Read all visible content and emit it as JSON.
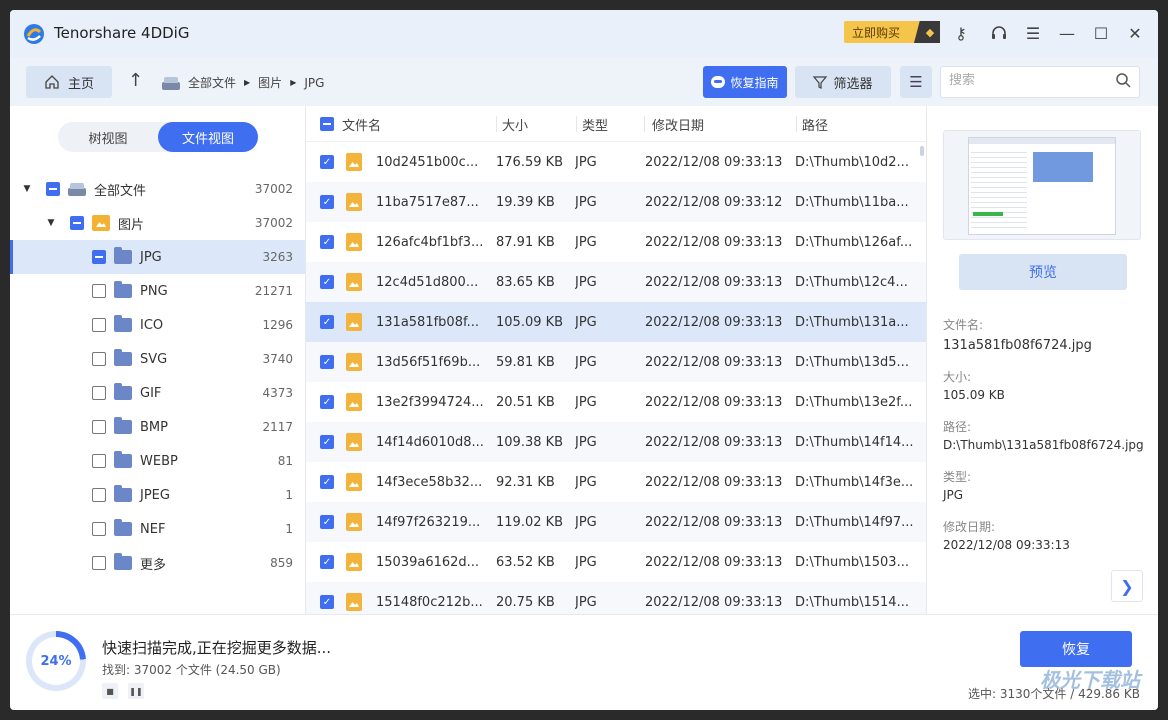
{
  "app": {
    "title": "Tenorshare 4DDiG",
    "buy_label": "立即购买"
  },
  "toolbar": {
    "home_label": "主页",
    "breadcrumb": [
      "全部文件",
      "图片",
      "JPG"
    ],
    "guide_label": "恢复指南",
    "filter_label": "筛选器",
    "search_placeholder": "搜索"
  },
  "sidebar": {
    "toggle": {
      "tree": "树视图",
      "file": "文件视图"
    },
    "items": [
      {
        "label": "全部文件",
        "count": "37002"
      },
      {
        "label": "图片",
        "count": "37002"
      },
      {
        "label": "JPG",
        "count": "3263"
      },
      {
        "label": "PNG",
        "count": "21271"
      },
      {
        "label": "ICO",
        "count": "1296"
      },
      {
        "label": "SVG",
        "count": "3740"
      },
      {
        "label": "GIF",
        "count": "4373"
      },
      {
        "label": "BMP",
        "count": "2117"
      },
      {
        "label": "WEBP",
        "count": "81"
      },
      {
        "label": "JPEG",
        "count": "1"
      },
      {
        "label": "NEF",
        "count": "1"
      },
      {
        "label": "更多",
        "count": "859"
      }
    ]
  },
  "table": {
    "headers": {
      "name": "文件名",
      "size": "大小",
      "type": "类型",
      "date": "修改日期",
      "path": "路径"
    },
    "rows": [
      {
        "name": "10d2451b00c...",
        "size": "176.59 KB",
        "type": "JPG",
        "date": "2022/12/08 09:33:13",
        "path": "D:\\Thumb\\10d2..."
      },
      {
        "name": "11ba7517e87...",
        "size": "19.39 KB",
        "type": "JPG",
        "date": "2022/12/08 09:33:12",
        "path": "D:\\Thumb\\11ba..."
      },
      {
        "name": "126afc4bf1bf3...",
        "size": "87.91 KB",
        "type": "JPG",
        "date": "2022/12/08 09:33:13",
        "path": "D:\\Thumb\\126af..."
      },
      {
        "name": "12c4d51d800...",
        "size": "83.65 KB",
        "type": "JPG",
        "date": "2022/12/08 09:33:13",
        "path": "D:\\Thumb\\12c4..."
      },
      {
        "name": "131a581fb08f...",
        "size": "105.09 KB",
        "type": "JPG",
        "date": "2022/12/08 09:33:13",
        "path": "D:\\Thumb\\131a..."
      },
      {
        "name": "13d56f51f69b...",
        "size": "59.81 KB",
        "type": "JPG",
        "date": "2022/12/08 09:33:13",
        "path": "D:\\Thumb\\13d5..."
      },
      {
        "name": "13e2f3994724...",
        "size": "20.51 KB",
        "type": "JPG",
        "date": "2022/12/08 09:33:13",
        "path": "D:\\Thumb\\13e2f..."
      },
      {
        "name": "14f14d6010d8...",
        "size": "109.38 KB",
        "type": "JPG",
        "date": "2022/12/08 09:33:13",
        "path": "D:\\Thumb\\14f14..."
      },
      {
        "name": "14f3ece58b32...",
        "size": "92.31 KB",
        "type": "JPG",
        "date": "2022/12/08 09:33:13",
        "path": "D:\\Thumb\\14f3e..."
      },
      {
        "name": "14f97f263219...",
        "size": "119.02 KB",
        "type": "JPG",
        "date": "2022/12/08 09:33:13",
        "path": "D:\\Thumb\\14f97..."
      },
      {
        "name": "15039a6162d...",
        "size": "63.52 KB",
        "type": "JPG",
        "date": "2022/12/08 09:33:13",
        "path": "D:\\Thumb\\1503..."
      },
      {
        "name": "15148f0c212b...",
        "size": "20.75 KB",
        "type": "JPG",
        "date": "2022/12/08 09:33:13",
        "path": "D:\\Thumb\\1514..."
      }
    ]
  },
  "details": {
    "preview_label": "预览",
    "name_label": "文件名:",
    "name_value": "131a581fb08f6724.jpg",
    "size_label": "大小:",
    "size_value": "105.09 KB",
    "path_label": "路径:",
    "path_value": "D:\\Thumb\\131a581fb08f6724.jpg",
    "type_label": "类型:",
    "type_value": "JPG",
    "date_label": "修改日期:",
    "date_value": "2022/12/08 09:33:13"
  },
  "status": {
    "progress_text": "24%",
    "progress_fraction": 0.24,
    "title": "快速扫描完成,正在挖掘更多数据...",
    "found": "找到: 37002 个文件 (24.50 GB)",
    "recover_label": "恢复",
    "selected_summary": "选中: 3130个文件 / 429.86 KB"
  },
  "watermark": "极光下载站",
  "colors": {
    "accent": "#3f6ef0",
    "selected_row": "#dce7fa",
    "buy": "#f5c44a"
  }
}
